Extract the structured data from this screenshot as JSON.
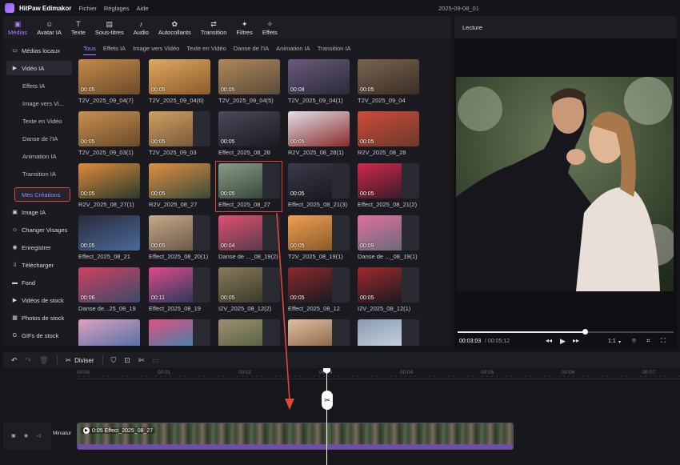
{
  "titlebar": {
    "app_name": "HitPaw Edimakor",
    "menu": [
      "Fichier",
      "Réglages",
      "Aide"
    ],
    "project_name": "2025-09-08_01"
  },
  "toolbar": {
    "items": [
      {
        "label": "Médias",
        "icon": "media-icon",
        "active": true
      },
      {
        "label": "Avatar IA",
        "icon": "avatar-icon"
      },
      {
        "label": "Texte",
        "icon": "text-icon"
      },
      {
        "label": "Sous-titres",
        "icon": "subtitles-icon"
      },
      {
        "label": "Audio",
        "icon": "music-note-icon"
      },
      {
        "label": "Autocollants",
        "icon": "sticker-icon"
      },
      {
        "label": "Transition",
        "icon": "transition-icon"
      },
      {
        "label": "Filtres",
        "icon": "filter-icon"
      },
      {
        "label": "Effets",
        "icon": "effects-icon"
      }
    ]
  },
  "sidebar": {
    "items": [
      {
        "label": "Médias locaux",
        "icon": "folder-icon"
      },
      {
        "label": "Vidéo IA",
        "icon": "video-ai-icon",
        "highlight": true
      },
      {
        "label": "Effets IA",
        "sub": true
      },
      {
        "label": "Image vers Vi...",
        "sub": true
      },
      {
        "label": "Texte en Vidéo",
        "sub": true
      },
      {
        "label": "Danse de l'IA",
        "sub": true
      },
      {
        "label": "Animation IA",
        "sub": true
      },
      {
        "label": "Transition IA",
        "sub": true
      },
      {
        "label": "Mes Créations",
        "sub": true,
        "selected": true
      },
      {
        "label": "Image IA",
        "icon": "image-ai-icon"
      },
      {
        "label": "Changer Visages",
        "icon": "face-swap-icon"
      },
      {
        "label": "Enregistrer",
        "icon": "record-icon"
      },
      {
        "label": "Télécharger",
        "icon": "download-icon"
      },
      {
        "label": "Fond",
        "icon": "background-icon"
      },
      {
        "label": "Vidéos de stock",
        "icon": "stock-video-icon"
      },
      {
        "label": "Photos de stock",
        "icon": "stock-photo-icon"
      },
      {
        "label": "GIFs de stock",
        "icon": "gif-icon"
      }
    ]
  },
  "media": {
    "subtabs": [
      "Tous",
      "Effets IA",
      "Image vers Vidéo",
      "Texte en Vidéo",
      "Danse de l'IA",
      "Animation IA",
      "Transition IA"
    ],
    "active_subtab": "Tous",
    "cards": [
      {
        "name": "T2V_2025_09_04(7)",
        "duration": "00:05",
        "c1": "#6b4a2a",
        "c2": "#c48a4a"
      },
      {
        "name": "T2V_2025_09_04(6)",
        "duration": "00:05",
        "c1": "#8a5a2a",
        "c2": "#e0a860"
      },
      {
        "name": "T2V_2025_09_04(5)",
        "duration": "00:05",
        "c1": "#5a4a3a",
        "c2": "#b08858"
      },
      {
        "name": "T2V_2025_09_04(1)",
        "duration": "00:08",
        "c1": "#2a2a3a",
        "c2": "#6a5a7a"
      },
      {
        "name": "T2V_2025_09_04",
        "duration": "00:05",
        "c1": "#3a2e26",
        "c2": "#7a6450"
      },
      {
        "name": "T2V_2025_09_03(1)",
        "duration": "00:05",
        "c1": "#6a4a2a",
        "c2": "#c89050"
      },
      {
        "name": "T2V_2025_09_03",
        "duration": "00:05",
        "c1": "#7a5a3a",
        "c2": "#d0a060"
      },
      {
        "name": "Effect_2025_08_28",
        "duration": "00:05",
        "c1": "#1a1a22",
        "c2": "#4a4a5a"
      },
      {
        "name": "R2V_2025_08_28(1)",
        "duration": "00:05",
        "c1": "#8a2a2a",
        "c2": "#e0e0e8"
      },
      {
        "name": "R2V_2025_08_28",
        "duration": "00:05",
        "c1": "#6a3a2a",
        "c2": "#d04a3a"
      },
      {
        "name": "R2V_2025_08_27(1)",
        "duration": "00:05",
        "c1": "#2a3a2a",
        "c2": "#e08a3a"
      },
      {
        "name": "R2V_2025_08_27",
        "duration": "00:05",
        "c1": "#3a4a3a",
        "c2": "#e09040"
      },
      {
        "name": "Effect_2025_08_27",
        "duration": "00:05",
        "c1": "#3a4a3a",
        "c2": "#8a9a8a",
        "selected": true
      },
      {
        "name": "Effect_2025_08_21(3)",
        "duration": "00:05",
        "c1": "#1a1a22",
        "c2": "#3a3a4a"
      },
      {
        "name": "Effect_2025_08_21(2)",
        "duration": "00:05",
        "c1": "#3a1a2a",
        "c2": "#d02a4a"
      },
      {
        "name": "Effect_2025_08_21",
        "duration": "00:05",
        "c1": "#4a6a9a",
        "c2": "#2a2a3a"
      },
      {
        "name": "Effect_2025_08_20(1)",
        "duration": "00:05",
        "c1": "#6a5a4a",
        "c2": "#c8a888"
      },
      {
        "name": "Danse de ..._08_19(2)",
        "duration": "00:04",
        "c1": "#5a3a4a",
        "c2": "#e05070"
      },
      {
        "name": "T2V_2025_08_19(1)",
        "duration": "00:05",
        "c1": "#8a5a2a",
        "c2": "#f0a050"
      },
      {
        "name": "Danse de ..._08_19(1)",
        "duration": "00:09",
        "c1": "#6a6a7a",
        "c2": "#e070a0"
      },
      {
        "name": "Danse de...25_08_19",
        "duration": "00:06",
        "c1": "#3a4a6a",
        "c2": "#d04060"
      },
      {
        "name": "Effect_2025_08_19",
        "duration": "00:11",
        "c1": "#2a3a5a",
        "c2": "#e04a8a"
      },
      {
        "name": "I2V_2025_08_12(2)",
        "duration": "00:05",
        "c1": "#3a3a2a",
        "c2": "#8a7a5a"
      },
      {
        "name": "Effect_2025_08_12",
        "duration": "00:05",
        "c1": "#1a1a22",
        "c2": "#8a2a2a"
      },
      {
        "name": "I2V_2025_08_12(1)",
        "duration": "00:05",
        "c1": "#1a1a22",
        "c2": "#a02a2a"
      },
      {
        "name": "",
        "duration": "",
        "c1": "#3a6aa0",
        "c2": "#e0a0c0"
      },
      {
        "name": "",
        "duration": "",
        "c1": "#2a8ab0",
        "c2": "#e05080"
      },
      {
        "name": "",
        "duration": "",
        "c1": "#4a5a3a",
        "c2": "#a09070"
      },
      {
        "name": "",
        "duration": "",
        "c1": "#7a5a3a",
        "c2": "#e0c0a0"
      },
      {
        "name": "",
        "duration": "",
        "c1": "#d0dae8",
        "c2": "#8a9ab0"
      }
    ]
  },
  "preview": {
    "title": "Lecture",
    "current_time": "00:03:03",
    "total_time": "/ 00:05:12",
    "progress": 0.59,
    "ratio": "1:1"
  },
  "timeline": {
    "split_label": "Diviser",
    "ticks": [
      "00:00",
      "00:01",
      "00:02",
      "00:03",
      "00:04",
      "00:05",
      "00:06",
      "00:07"
    ],
    "track_label": "Miniatur",
    "clip_label": "0:05 Effect_2025_08_27"
  },
  "colors": {
    "accent": "#b67cff",
    "annotation": "#e0473b",
    "background": "#141419"
  }
}
